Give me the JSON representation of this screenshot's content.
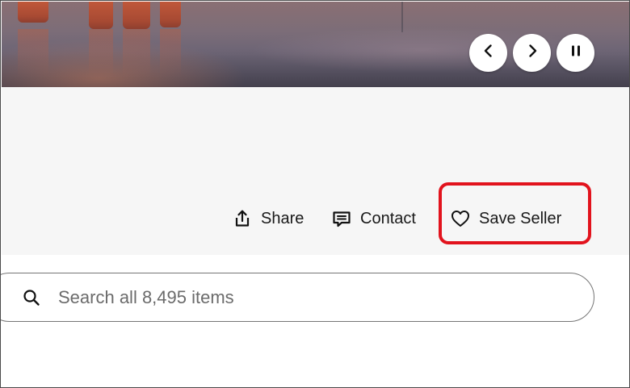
{
  "hero": {
    "prev_icon": "chevron-left-icon",
    "next_icon": "chevron-right-icon",
    "pause_icon": "pause-icon"
  },
  "actions": {
    "share_label": "Share",
    "contact_label": "Contact",
    "save_seller_label": "Save Seller"
  },
  "search": {
    "placeholder": "Search all 8,495 items",
    "value": ""
  },
  "colors": {
    "highlight": "#e2131d",
    "header_bg": "#f6f6f6",
    "text": "#191919"
  }
}
